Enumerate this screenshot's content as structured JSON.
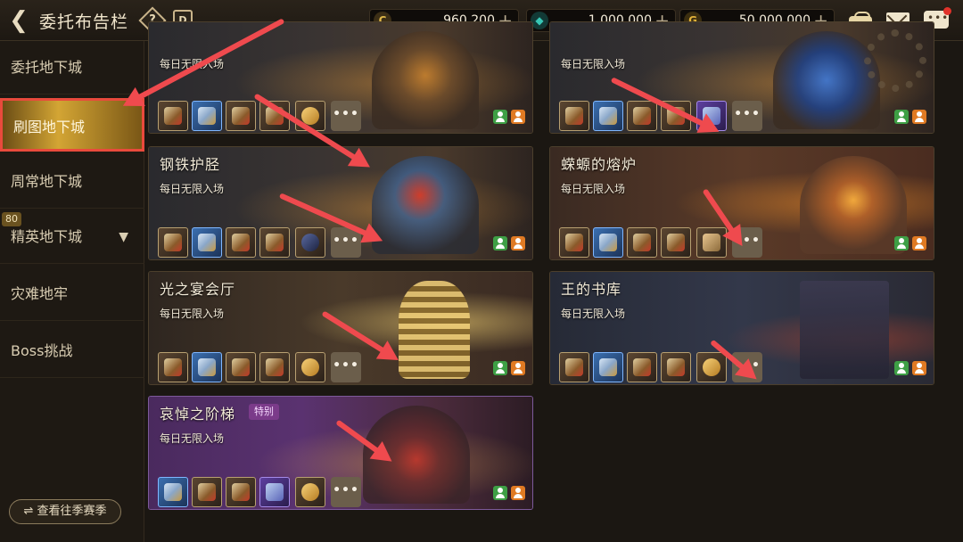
{
  "header": {
    "back_icon": "back-arrow-icon",
    "title": "委托布告栏",
    "help_label": "?",
    "calendar_label": "D"
  },
  "currencies": [
    {
      "icon": "gold-coin-icon",
      "symbol": "C",
      "value": "960,200",
      "color": "#e0b84a"
    },
    {
      "icon": "crystal-icon",
      "symbol": "◆",
      "value": "1,000,000",
      "color": "#38c7b5"
    },
    {
      "icon": "medal-icon",
      "symbol": "G",
      "value": "50,000,000",
      "color": "#e2b23a"
    }
  ],
  "top_icons": [
    "bag-icon",
    "mail-icon",
    "chat-icon"
  ],
  "sidebar": {
    "items": [
      {
        "label": "委托地下城",
        "active": false
      },
      {
        "label": "刷图地下城",
        "active": true
      },
      {
        "label": "周常地下城",
        "active": false
      },
      {
        "label": "精英地下城",
        "active": false,
        "level": "80",
        "expand_icon": "chevron-down-icon"
      },
      {
        "label": "灾难地牢",
        "active": false
      },
      {
        "label": "Boss挑战",
        "active": false
      }
    ],
    "season_button": "⇌ 查看往季赛季"
  },
  "cards": [
    {
      "name": "",
      "subtitle": "每日无限入场",
      "special": false,
      "more": "•••"
    },
    {
      "name": "",
      "subtitle": "每日无限入场",
      "special": false,
      "more": "•••"
    },
    {
      "name": "钢铁护胫",
      "subtitle": "每日无限入场",
      "special": false,
      "more": "•••"
    },
    {
      "name": "蝾螈的熔炉",
      "subtitle": "每日无限入场",
      "special": false,
      "more": "•••"
    },
    {
      "name": "光之宴会厅",
      "subtitle": "每日无限入场",
      "special": false,
      "more": "•••"
    },
    {
      "name": "王的书库",
      "subtitle": "每日无限入场",
      "special": false,
      "more": "•••"
    },
    {
      "name": "哀悼之阶梯",
      "subtitle": "每日无限入场",
      "special": true,
      "tag": "特别",
      "more": "•••"
    }
  ],
  "accent_colors": {
    "highlight_border": "#e94a3c",
    "annotation_arrow": "#ef4a4e",
    "active_tab": "#d3a534"
  }
}
